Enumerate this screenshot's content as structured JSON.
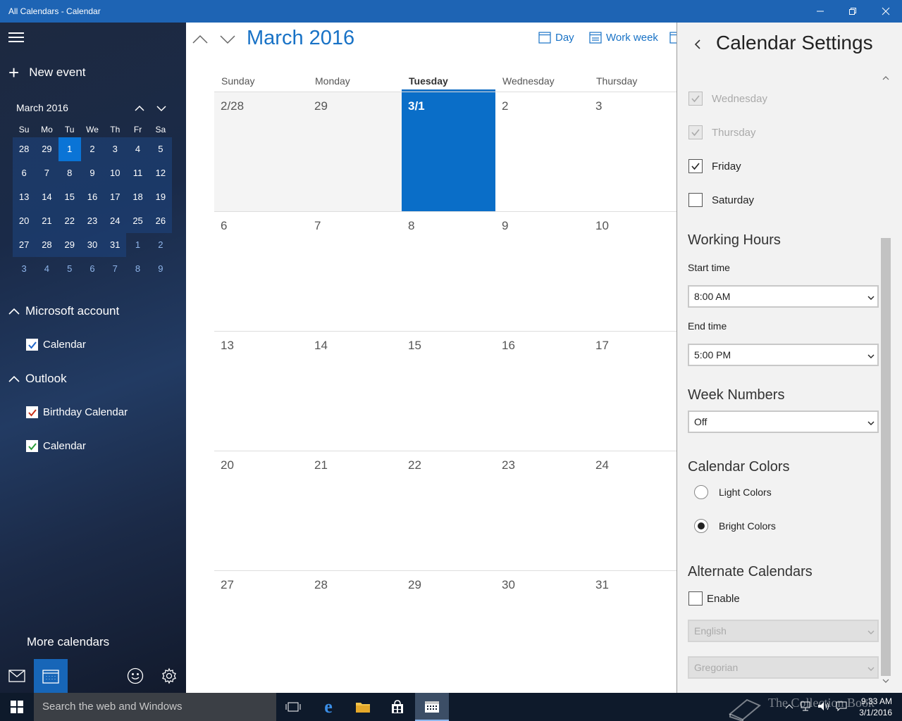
{
  "window": {
    "title": "All Calendars - Calendar"
  },
  "sidebar": {
    "new_event": "New event",
    "mini_calendar": {
      "month_label": "March 2016",
      "days_of_week": [
        "Su",
        "Mo",
        "Tu",
        "We",
        "Th",
        "Fr",
        "Sa"
      ],
      "weeks": [
        [
          "28",
          "29",
          "1",
          "2",
          "3",
          "4",
          "5"
        ],
        [
          "6",
          "7",
          "8",
          "9",
          "10",
          "11",
          "12"
        ],
        [
          "13",
          "14",
          "15",
          "16",
          "17",
          "18",
          "19"
        ],
        [
          "20",
          "21",
          "22",
          "23",
          "24",
          "25",
          "26"
        ],
        [
          "27",
          "28",
          "29",
          "30",
          "31",
          "1",
          "2"
        ],
        [
          "3",
          "4",
          "5",
          "6",
          "7",
          "8",
          "9"
        ]
      ]
    },
    "groups": [
      {
        "name": "Microsoft account",
        "calendars": [
          {
            "label": "Calendar",
            "color": "#1e64c8",
            "checked": true
          }
        ]
      },
      {
        "name": "Outlook",
        "calendars": [
          {
            "label": "Birthday Calendar",
            "color": "#c8311a",
            "checked": true
          },
          {
            "label": "Calendar",
            "color": "#2a9d3a",
            "checked": true
          }
        ]
      }
    ],
    "more_calendars": "More calendars"
  },
  "main": {
    "month_title": "March 2016",
    "view_buttons": [
      {
        "label": "Day",
        "icon": "calendar-day-icon"
      },
      {
        "label": "Work week",
        "icon": "calendar-workweek-icon"
      }
    ],
    "days_of_week": [
      "Sunday",
      "Monday",
      "Tuesday",
      "Wednesday",
      "Thursday"
    ],
    "weeks": [
      [
        "2/28",
        "29",
        "3/1",
        "2",
        "3"
      ],
      [
        "6",
        "7",
        "8",
        "9",
        "10"
      ],
      [
        "13",
        "14",
        "15",
        "16",
        "17"
      ],
      [
        "20",
        "21",
        "22",
        "23",
        "24"
      ],
      [
        "27",
        "28",
        "29",
        "30",
        "31"
      ]
    ],
    "accent_color": "#1872c6"
  },
  "settings": {
    "title": "Calendar Settings",
    "days": [
      {
        "label": "Wednesday",
        "checked": true,
        "disabled": true
      },
      {
        "label": "Thursday",
        "checked": true,
        "disabled": true
      },
      {
        "label": "Friday",
        "checked": true,
        "disabled": false
      },
      {
        "label": "Saturday",
        "checked": false,
        "disabled": false
      }
    ],
    "working_hours": {
      "heading": "Working Hours",
      "start_label": "Start time",
      "start_value": "8:00 AM",
      "end_label": "End time",
      "end_value": "5:00 PM"
    },
    "week_numbers": {
      "heading": "Week Numbers",
      "value": "Off"
    },
    "calendar_colors": {
      "heading": "Calendar Colors",
      "options": [
        {
          "label": "Light Colors",
          "selected": false
        },
        {
          "label": "Bright Colors",
          "selected": true
        }
      ]
    },
    "alternate_calendars": {
      "heading": "Alternate Calendars",
      "enable_label": "Enable",
      "enabled": false,
      "language_value": "English",
      "type_value": "Gregorian"
    }
  },
  "taskbar": {
    "search_placeholder": "Search the web and Windows",
    "time": "9:33 AM",
    "date": "3/1/2016",
    "watermark": "The Collection Book"
  }
}
